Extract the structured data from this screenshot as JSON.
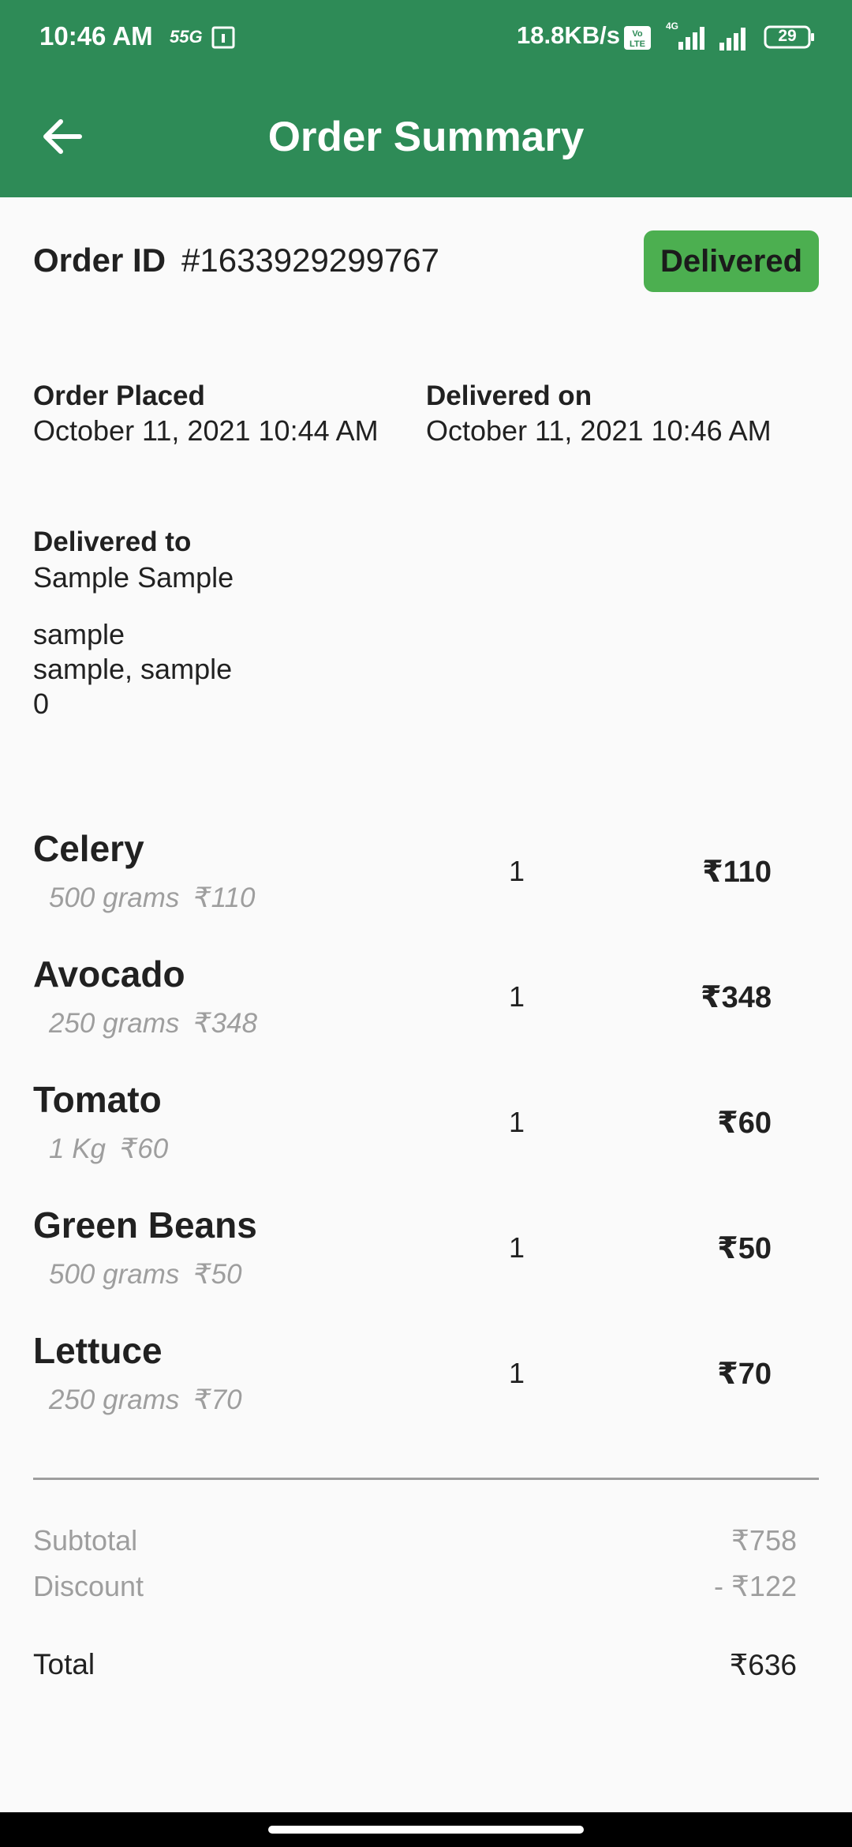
{
  "status_bar": {
    "time": "10:46 AM",
    "network_speed": "18.8KB/s",
    "battery": "29",
    "icons": [
      "55g-icon",
      "calendar-icon",
      "volte-icon",
      "signal-4g-icon",
      "signal-icon",
      "battery-icon"
    ]
  },
  "app_bar": {
    "title": "Order Summary",
    "back_icon": "arrow-left-icon"
  },
  "order": {
    "id_label": "Order ID",
    "id_value": "#1633929299767",
    "status": "Delivered",
    "placed_label": "Order Placed",
    "placed_value": "October 11, 2021 10:44 AM",
    "delivered_on_label": "Delivered on",
    "delivered_on_value": "October 11, 2021 10:46 AM",
    "delivered_to_label": "Delivered to",
    "recipient_name": "Sample Sample",
    "address_line1": "sample",
    "address_line2": "sample, sample",
    "address_line3": "0"
  },
  "items": [
    {
      "name": "Celery",
      "unit": "500 grams",
      "unit_price": "₹110",
      "qty": "1",
      "price": "₹110"
    },
    {
      "name": "Avocado",
      "unit": "250 grams",
      "unit_price": "₹348",
      "qty": "1",
      "price": "₹348"
    },
    {
      "name": "Tomato",
      "unit": "1 Kg",
      "unit_price": "₹60",
      "qty": "1",
      "price": "₹60"
    },
    {
      "name": "Green Beans",
      "unit": "500 grams",
      "unit_price": "₹50",
      "qty": "1",
      "price": "₹50"
    },
    {
      "name": "Lettuce",
      "unit": "250 grams",
      "unit_price": "₹70",
      "qty": "1",
      "price": "₹70"
    }
  ],
  "summary": {
    "subtotal_label": "Subtotal",
    "subtotal_value": "₹758",
    "discount_label": "Discount",
    "discount_value": "- ₹122",
    "total_label": "Total",
    "total_value": "₹636"
  },
  "colors": {
    "primary": "#2e8b57",
    "badge": "#4caf50",
    "muted_text": "#9e9e9e",
    "text": "#212121"
  }
}
